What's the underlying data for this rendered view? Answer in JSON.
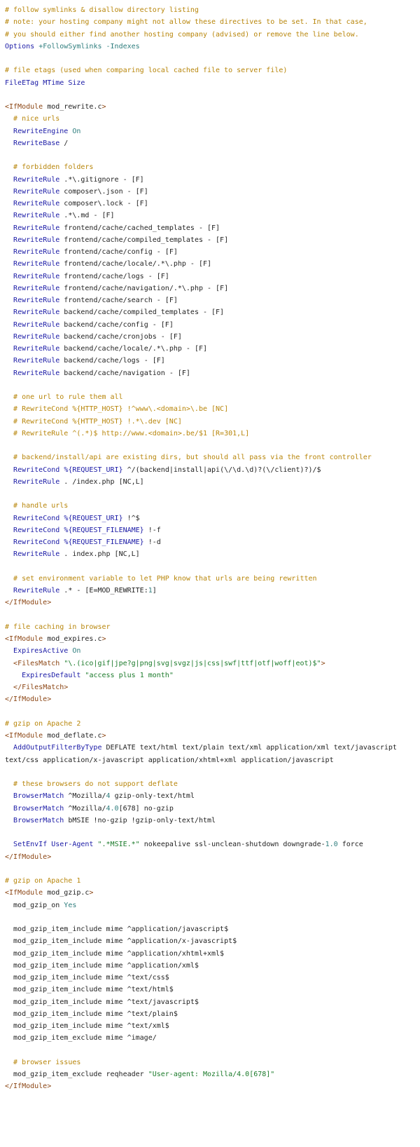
{
  "lines": [
    [
      {
        "t": "# follow symlinks & disallow directory listing",
        "k": "c"
      }
    ],
    [
      {
        "t": "# note: your hosting company might not allow these directives to be set. In that case,",
        "k": "c"
      }
    ],
    [
      {
        "t": "# you should either find another hosting company (advised) or remove the line below.",
        "k": "c"
      }
    ],
    [
      {
        "t": "Options",
        "k": "k"
      },
      {
        "t": " "
      },
      {
        "t": "+FollowSymlinks -Indexes",
        "k": "v"
      }
    ],
    [],
    [
      {
        "t": "# file etags (used when comparing local cached file to server file)",
        "k": "c"
      }
    ],
    [
      {
        "t": "FileETag",
        "k": "k"
      },
      {
        "t": " "
      },
      {
        "t": "MTime Size",
        "k": "k"
      }
    ],
    [],
    [
      {
        "t": "<IfModule",
        "k": "t"
      },
      {
        "t": " mod_rewrite.c"
      },
      {
        "t": ">",
        "k": "t"
      }
    ],
    [
      {
        "t": "  "
      },
      {
        "t": "# nice urls",
        "k": "c"
      }
    ],
    [
      {
        "t": "  "
      },
      {
        "t": "RewriteEngine",
        "k": "k"
      },
      {
        "t": " "
      },
      {
        "t": "On",
        "k": "v"
      }
    ],
    [
      {
        "t": "  "
      },
      {
        "t": "RewriteBase",
        "k": "k"
      },
      {
        "t": " /"
      }
    ],
    [],
    [
      {
        "t": "  "
      },
      {
        "t": "# forbidden folders",
        "k": "c"
      }
    ],
    [
      {
        "t": "  "
      },
      {
        "t": "RewriteRule",
        "k": "k"
      },
      {
        "t": " .*\\.gitignore - [F]"
      }
    ],
    [
      {
        "t": "  "
      },
      {
        "t": "RewriteRule",
        "k": "k"
      },
      {
        "t": " composer\\.json - [F]"
      }
    ],
    [
      {
        "t": "  "
      },
      {
        "t": "RewriteRule",
        "k": "k"
      },
      {
        "t": " composer\\.lock - [F]"
      }
    ],
    [
      {
        "t": "  "
      },
      {
        "t": "RewriteRule",
        "k": "k"
      },
      {
        "t": " .*\\.md - [F]"
      }
    ],
    [
      {
        "t": "  "
      },
      {
        "t": "RewriteRule",
        "k": "k"
      },
      {
        "t": " frontend/cache/cached_templates - [F]"
      }
    ],
    [
      {
        "t": "  "
      },
      {
        "t": "RewriteRule",
        "k": "k"
      },
      {
        "t": " frontend/cache/compiled_templates - [F]"
      }
    ],
    [
      {
        "t": "  "
      },
      {
        "t": "RewriteRule",
        "k": "k"
      },
      {
        "t": " frontend/cache/config - [F]"
      }
    ],
    [
      {
        "t": "  "
      },
      {
        "t": "RewriteRule",
        "k": "k"
      },
      {
        "t": " frontend/cache/locale/.*\\.php - [F]"
      }
    ],
    [
      {
        "t": "  "
      },
      {
        "t": "RewriteRule",
        "k": "k"
      },
      {
        "t": " frontend/cache/logs - [F]"
      }
    ],
    [
      {
        "t": "  "
      },
      {
        "t": "RewriteRule",
        "k": "k"
      },
      {
        "t": " frontend/cache/navigation/.*\\.php - [F]"
      }
    ],
    [
      {
        "t": "  "
      },
      {
        "t": "RewriteRule",
        "k": "k"
      },
      {
        "t": " frontend/cache/search - [F]"
      }
    ],
    [
      {
        "t": "  "
      },
      {
        "t": "RewriteRule",
        "k": "k"
      },
      {
        "t": " backend/cache/compiled_templates - [F]"
      }
    ],
    [
      {
        "t": "  "
      },
      {
        "t": "RewriteRule",
        "k": "k"
      },
      {
        "t": " backend/cache/config - [F]"
      }
    ],
    [
      {
        "t": "  "
      },
      {
        "t": "RewriteRule",
        "k": "k"
      },
      {
        "t": " backend/cache/cronjobs - [F]"
      }
    ],
    [
      {
        "t": "  "
      },
      {
        "t": "RewriteRule",
        "k": "k"
      },
      {
        "t": " backend/cache/locale/.*\\.php - [F]"
      }
    ],
    [
      {
        "t": "  "
      },
      {
        "t": "RewriteRule",
        "k": "k"
      },
      {
        "t": " backend/cache/logs - [F]"
      }
    ],
    [
      {
        "t": "  "
      },
      {
        "t": "RewriteRule",
        "k": "k"
      },
      {
        "t": " backend/cache/navigation - [F]"
      }
    ],
    [],
    [
      {
        "t": "  "
      },
      {
        "t": "# one url to rule them all",
        "k": "c"
      }
    ],
    [
      {
        "t": "  "
      },
      {
        "t": "# RewriteCond %{HTTP_HOST} !^www\\.<domain>\\.be [NC]",
        "k": "c"
      }
    ],
    [
      {
        "t": "  "
      },
      {
        "t": "# RewriteCond %{HTTP_HOST} !.*\\.dev [NC]",
        "k": "c"
      }
    ],
    [
      {
        "t": "  "
      },
      {
        "t": "# RewriteRule ^(.*)$ http://www.<domain>.be/$1 [R=301,L]",
        "k": "c"
      }
    ],
    [],
    [
      {
        "t": "  "
      },
      {
        "t": "# backend/install/api are existing dirs, but should all pass via the front controller",
        "k": "c"
      }
    ],
    [
      {
        "t": "  "
      },
      {
        "t": "RewriteCond",
        "k": "k"
      },
      {
        "t": " "
      },
      {
        "t": "%{REQUEST_URI}",
        "k": "k"
      },
      {
        "t": " ^/(backend|install|api(\\/\\d.\\d)?(\\/client)?)/$"
      }
    ],
    [
      {
        "t": "  "
      },
      {
        "t": "RewriteRule",
        "k": "k"
      },
      {
        "t": " . /index.php [NC,L]"
      }
    ],
    [],
    [
      {
        "t": "  "
      },
      {
        "t": "# handle urls",
        "k": "c"
      }
    ],
    [
      {
        "t": "  "
      },
      {
        "t": "RewriteCond",
        "k": "k"
      },
      {
        "t": " "
      },
      {
        "t": "%{REQUEST_URI}",
        "k": "k"
      },
      {
        "t": " !^$"
      }
    ],
    [
      {
        "t": "  "
      },
      {
        "t": "RewriteCond",
        "k": "k"
      },
      {
        "t": " "
      },
      {
        "t": "%{REQUEST_FILENAME}",
        "k": "k"
      },
      {
        "t": " !-f"
      }
    ],
    [
      {
        "t": "  "
      },
      {
        "t": "RewriteCond",
        "k": "k"
      },
      {
        "t": " "
      },
      {
        "t": "%{REQUEST_FILENAME}",
        "k": "k"
      },
      {
        "t": " !-d"
      }
    ],
    [
      {
        "t": "  "
      },
      {
        "t": "RewriteRule",
        "k": "k"
      },
      {
        "t": " . index.php [NC,L]"
      }
    ],
    [],
    [
      {
        "t": "  "
      },
      {
        "t": "# set environment variable to let PHP know that urls are being rewritten",
        "k": "c"
      }
    ],
    [
      {
        "t": "  "
      },
      {
        "t": "RewriteRule",
        "k": "k"
      },
      {
        "t": " .* - [E=MOD_REWRITE:"
      },
      {
        "t": "1",
        "k": "v"
      },
      {
        "t": "]"
      }
    ],
    [
      {
        "t": "</IfModule>",
        "k": "t"
      }
    ],
    [],
    [
      {
        "t": "# file caching in browser",
        "k": "c"
      }
    ],
    [
      {
        "t": "<IfModule",
        "k": "t"
      },
      {
        "t": " mod_expires.c"
      },
      {
        "t": ">",
        "k": "t"
      }
    ],
    [
      {
        "t": "  "
      },
      {
        "t": "ExpiresActive",
        "k": "k"
      },
      {
        "t": " "
      },
      {
        "t": "On",
        "k": "v"
      }
    ],
    [
      {
        "t": "  "
      },
      {
        "t": "<FilesMatch",
        "k": "t"
      },
      {
        "t": " "
      },
      {
        "t": "\"\\.(ico|gif|jpe?g|png|svg|svgz|js|css|swf|ttf|otf|woff|eot)$\"",
        "k": "s"
      },
      {
        "t": ">",
        "k": "t"
      }
    ],
    [
      {
        "t": "    "
      },
      {
        "t": "ExpiresDefault",
        "k": "k"
      },
      {
        "t": " "
      },
      {
        "t": "\"access plus 1 month\"",
        "k": "s"
      }
    ],
    [
      {
        "t": "  "
      },
      {
        "t": "</FilesMatch>",
        "k": "t"
      }
    ],
    [
      {
        "t": "</IfModule>",
        "k": "t"
      }
    ],
    [],
    [
      {
        "t": "# gzip on Apache 2",
        "k": "c"
      }
    ],
    [
      {
        "t": "<IfModule",
        "k": "t"
      },
      {
        "t": " mod_deflate.c"
      },
      {
        "t": ">",
        "k": "t"
      }
    ],
    [
      {
        "t": "  "
      },
      {
        "t": "AddOutputFilterByType",
        "k": "k"
      },
      {
        "t": " DEFLATE text/html text/plain text/xml application/xml text/javascript"
      }
    ],
    [
      {
        "t": "text/css application/x-javascript application/xhtml+xml application/javascript"
      }
    ],
    [],
    [
      {
        "t": "  "
      },
      {
        "t": "# these browsers do not support deflate",
        "k": "c"
      }
    ],
    [
      {
        "t": "  "
      },
      {
        "t": "BrowserMatch",
        "k": "k"
      },
      {
        "t": " ^Mozilla/"
      },
      {
        "t": "4",
        "k": "v"
      },
      {
        "t": " gzip-only-text/html"
      }
    ],
    [
      {
        "t": "  "
      },
      {
        "t": "BrowserMatch",
        "k": "k"
      },
      {
        "t": " ^Mozilla/"
      },
      {
        "t": "4.0",
        "k": "v"
      },
      {
        "t": "[678] no-gzip"
      }
    ],
    [
      {
        "t": "  "
      },
      {
        "t": "BrowserMatch",
        "k": "k"
      },
      {
        "t": " bMSIE !no-gzip !gzip-only-text/html"
      }
    ],
    [],
    [
      {
        "t": "  "
      },
      {
        "t": "SetEnvIf",
        "k": "k"
      },
      {
        "t": " "
      },
      {
        "t": "User-Agent",
        "k": "k"
      },
      {
        "t": " "
      },
      {
        "t": "\".*MSIE.*\"",
        "k": "s"
      },
      {
        "t": " nokeepalive ssl-unclean-shutdown downgrade-"
      },
      {
        "t": "1.0",
        "k": "v"
      },
      {
        "t": " force"
      }
    ],
    [
      {
        "t": "</IfModule>",
        "k": "t"
      }
    ],
    [],
    [
      {
        "t": "# gzip on Apache 1",
        "k": "c"
      }
    ],
    [
      {
        "t": "<IfModule",
        "k": "t"
      },
      {
        "t": " mod_gzip.c"
      },
      {
        "t": ">",
        "k": "t"
      }
    ],
    [
      {
        "t": "  mod_gzip_on "
      },
      {
        "t": "Yes",
        "k": "v"
      }
    ],
    [],
    [
      {
        "t": "  mod_gzip_item_include mime ^application/javascript$"
      }
    ],
    [
      {
        "t": "  mod_gzip_item_include mime ^application/x-javascript$"
      }
    ],
    [
      {
        "t": "  mod_gzip_item_include mime ^application/xhtml+xml$"
      }
    ],
    [
      {
        "t": "  mod_gzip_item_include mime ^application/xml$"
      }
    ],
    [
      {
        "t": "  mod_gzip_item_include mime ^text/css$"
      }
    ],
    [
      {
        "t": "  mod_gzip_item_include mime ^text/html$"
      }
    ],
    [
      {
        "t": "  mod_gzip_item_include mime ^text/javascript$"
      }
    ],
    [
      {
        "t": "  mod_gzip_item_include mime ^text/plain$"
      }
    ],
    [
      {
        "t": "  mod_gzip_item_include mime ^text/xml$"
      }
    ],
    [
      {
        "t": "  mod_gzip_item_exclude mime ^image/"
      }
    ],
    [],
    [
      {
        "t": "  "
      },
      {
        "t": "# browser issues",
        "k": "c"
      }
    ],
    [
      {
        "t": "  mod_gzip_item_exclude reqheader "
      },
      {
        "t": "\"User-agent: Mozilla/4.0[678]\"",
        "k": "s"
      }
    ],
    [
      {
        "t": "</IfModule>",
        "k": "t"
      }
    ]
  ]
}
